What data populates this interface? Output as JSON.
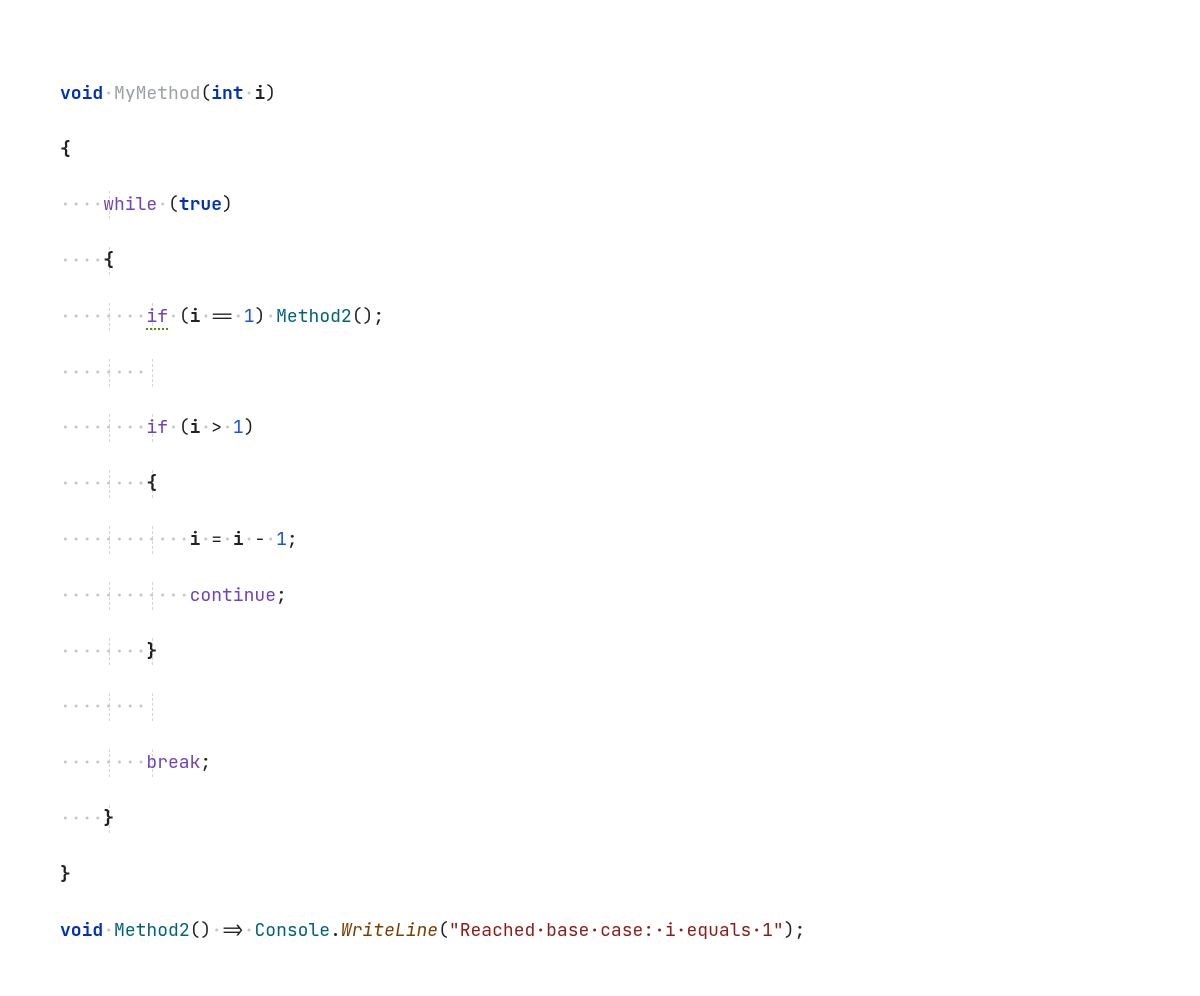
{
  "code": {
    "l1": {
      "void": "void",
      "sp": "·",
      "name": "MyMethod",
      "lp": "(",
      "int": "int",
      "param": "i",
      "rp": ")"
    },
    "l2": {
      "brace": "{"
    },
    "l3": {
      "ws": "····",
      "while": "while",
      "sp": "·",
      "lp": "(",
      "true": "true",
      "rp": ")"
    },
    "l4": {
      "ws": "····",
      "brace": "{"
    },
    "l5": {
      "ws": "········",
      "if": "if",
      "sp": "·",
      "lp": "(",
      "i": "i",
      "eq": "==",
      "one": "1",
      "rp": ")",
      "method": "Method2",
      "call": "()",
      "semi": ";"
    },
    "l6": {
      "ws": "········"
    },
    "l7": {
      "ws": "········",
      "if": "if",
      "sp": "·",
      "lp": "(",
      "i": "i",
      "gt": ">",
      "one": "1",
      "rp": ")"
    },
    "l8": {
      "ws": "········",
      "brace": "{"
    },
    "l9": {
      "ws": "············",
      "i1": "i",
      "sp": "·",
      "eq": "=",
      "i2": "i",
      "minus": "-",
      "one": "1",
      "semi": ";"
    },
    "l10": {
      "ws": "············",
      "continue": "continue",
      "semi": ";"
    },
    "l11": {
      "ws": "········",
      "brace": "}"
    },
    "l12": {
      "ws": "········"
    },
    "l13": {
      "ws": "········",
      "break": "break",
      "semi": ";"
    },
    "l14": {
      "ws": "····",
      "brace": "}"
    },
    "l15": {
      "brace": "}"
    },
    "l16": {
      "void": "void",
      "sp": "·",
      "method": "Method2",
      "call": "()",
      "arrow": "=>",
      "cls": "Console",
      "dot": ".",
      "wl": "WriteLine",
      "lp": "(",
      "str": "\"Reached·base·case:·i·equals·1\"",
      "rp": ")",
      "semi": ";"
    }
  },
  "guides": {
    "lvl1_ch": 4.5,
    "lvl2_ch": 8.5
  }
}
